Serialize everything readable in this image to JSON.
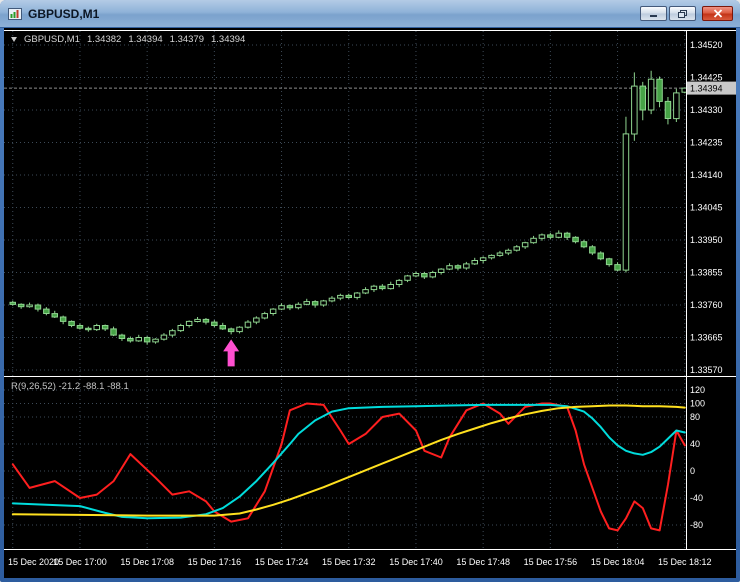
{
  "window": {
    "title": "GBPUSD,M1"
  },
  "header": {
    "symbol": "GBPUSD,M1",
    "open": "1.34382",
    "high": "1.34394",
    "low": "1.34379",
    "close": "1.34394"
  },
  "indicator_header": "R(9,26,52) -21.2 -88.1 -88.1",
  "axes": {
    "price_labels": [
      "1.34520",
      "1.34425",
      "1.34330",
      "1.34235",
      "1.34140",
      "1.34045",
      "1.33950",
      "1.33855",
      "1.33760",
      "1.33665",
      "1.33570"
    ],
    "indicator_labels": [
      "120",
      "100",
      "80",
      "40",
      "0",
      "-40",
      "-80"
    ],
    "time_labels": [
      "15 Dec 2020",
      "15 Dec 17:00",
      "15 Dec 17:08",
      "15 Dec 17:16",
      "15 Dec 17:24",
      "15 Dec 17:32",
      "15 Dec 17:40",
      "15 Dec 17:48",
      "15 Dec 17:56",
      "15 Dec 18:04",
      "15 Dec 18:12"
    ],
    "current_price": "1.34394"
  },
  "colors": {
    "background": "#000000",
    "grid": "#3d4a57",
    "frame": "#ffffff",
    "bull_stroke": "#8fd48f",
    "bear_fill": "#47a347",
    "candle_fill": "#000000",
    "axis_text": "#ffffff",
    "badge_bg": "#c8c8c8",
    "badge_text": "#000000",
    "bid_line": "#8c8c8c",
    "marker": "#ff4fd0",
    "osc_fast": "#ff1f1f",
    "osc_medium": "#00dcdc",
    "osc_slow": "#ffe01f"
  },
  "chart_data": {
    "type": "candlestick",
    "symbol": "GBPUSD",
    "timeframe": "M1",
    "title": "GBPUSD,M1",
    "price_axis_range": [
      1.3357,
      1.3452
    ],
    "last_ohlc": {
      "open": 1.34382,
      "high": 1.34394,
      "low": 1.34379,
      "close": 1.34394
    },
    "candles": [
      [
        1.33768,
        1.33773,
        1.33758,
        1.33762
      ],
      [
        1.33762,
        1.33765,
        1.33749,
        1.33755
      ],
      [
        1.33755,
        1.33767,
        1.33752,
        1.3376
      ],
      [
        1.3376,
        1.33764,
        1.33741,
        1.33748
      ],
      [
        1.33748,
        1.33754,
        1.3373,
        1.33735
      ],
      [
        1.33735,
        1.33743,
        1.33722,
        1.33725
      ],
      [
        1.33725,
        1.33729,
        1.33704,
        1.33712
      ],
      [
        1.33712,
        1.33715,
        1.33695,
        1.337
      ],
      [
        1.337,
        1.33706,
        1.33688,
        1.33692
      ],
      [
        1.33692,
        1.33697,
        1.33682,
        1.33688
      ],
      [
        1.33688,
        1.33705,
        1.33684,
        1.337
      ],
      [
        1.337,
        1.33703,
        1.33684,
        1.3369
      ],
      [
        1.3369,
        1.33697,
        1.33669,
        1.33672
      ],
      [
        1.33672,
        1.33676,
        1.33655,
        1.33662
      ],
      [
        1.33662,
        1.33668,
        1.3365,
        1.33655
      ],
      [
        1.33655,
        1.33673,
        1.33652,
        1.33665
      ],
      [
        1.33665,
        1.33669,
        1.33644,
        1.33652
      ],
      [
        1.33652,
        1.33663,
        1.33647,
        1.3366
      ],
      [
        1.3366,
        1.33678,
        1.33656,
        1.33672
      ],
      [
        1.33672,
        1.3369,
        1.33666,
        1.33685
      ],
      [
        1.33685,
        1.33705,
        1.33681,
        1.337
      ],
      [
        1.337,
        1.33715,
        1.33694,
        1.33712
      ],
      [
        1.33712,
        1.33725,
        1.33709,
        1.33718
      ],
      [
        1.33718,
        1.33722,
        1.33703,
        1.3371
      ],
      [
        1.3371,
        1.33716,
        1.33695,
        1.337
      ],
      [
        1.337,
        1.33708,
        1.33687,
        1.3369
      ],
      [
        1.3369,
        1.33694,
        1.33674,
        1.33682
      ],
      [
        1.33682,
        1.33698,
        1.33677,
        1.33695
      ],
      [
        1.33695,
        1.33716,
        1.33691,
        1.3371
      ],
      [
        1.3371,
        1.33727,
        1.33704,
        1.33722
      ],
      [
        1.33722,
        1.3374,
        1.33718,
        1.33735
      ],
      [
        1.33735,
        1.33751,
        1.33729,
        1.33748
      ],
      [
        1.33748,
        1.33765,
        1.33745,
        1.33758
      ],
      [
        1.33758,
        1.33762,
        1.33745,
        1.33752
      ],
      [
        1.33752,
        1.33768,
        1.33747,
        1.33762
      ],
      [
        1.33762,
        1.33778,
        1.33759,
        1.3377
      ],
      [
        1.3377,
        1.33774,
        1.33752,
        1.3376
      ],
      [
        1.3376,
        1.33775,
        1.33755,
        1.33772
      ],
      [
        1.33772,
        1.33786,
        1.33768,
        1.3378
      ],
      [
        1.3378,
        1.33793,
        1.33774,
        1.33788
      ],
      [
        1.33788,
        1.33793,
        1.33778,
        1.33782
      ],
      [
        1.33782,
        1.33798,
        1.33776,
        1.33795
      ],
      [
        1.33795,
        1.33812,
        1.33792,
        1.33805
      ],
      [
        1.33805,
        1.33819,
        1.33798,
        1.33815
      ],
      [
        1.33815,
        1.33821,
        1.33803,
        1.33808
      ],
      [
        1.33808,
        1.33828,
        1.33805,
        1.3382
      ],
      [
        1.3382,
        1.33836,
        1.33812,
        1.33832
      ],
      [
        1.33832,
        1.33848,
        1.33827,
        1.33845
      ],
      [
        1.33845,
        1.33858,
        1.33841,
        1.33852
      ],
      [
        1.33852,
        1.33857,
        1.33836,
        1.33842
      ],
      [
        1.33842,
        1.3386,
        1.33838,
        1.33855
      ],
      [
        1.33855,
        1.33868,
        1.33849,
        1.33865
      ],
      [
        1.33865,
        1.33882,
        1.33862,
        1.33875
      ],
      [
        1.33875,
        1.33879,
        1.33861,
        1.33868
      ],
      [
        1.33868,
        1.33886,
        1.33863,
        1.3388
      ],
      [
        1.3388,
        1.33898,
        1.33877,
        1.3389
      ],
      [
        1.3389,
        1.33902,
        1.33882,
        1.33898
      ],
      [
        1.33898,
        1.33908,
        1.33893,
        1.33905
      ],
      [
        1.33905,
        1.33918,
        1.33901,
        1.33912
      ],
      [
        1.33912,
        1.33925,
        1.33906,
        1.3392
      ],
      [
        1.3392,
        1.33935,
        1.33916,
        1.3393
      ],
      [
        1.3393,
        1.33945,
        1.33924,
        1.33942
      ],
      [
        1.33942,
        1.33962,
        1.33939,
        1.33955
      ],
      [
        1.33955,
        1.33969,
        1.33948,
        1.33965
      ],
      [
        1.33965,
        1.33971,
        1.33953,
        1.33958
      ],
      [
        1.33958,
        1.33978,
        1.33955,
        1.3397
      ],
      [
        1.3397,
        1.33974,
        1.3395,
        1.33958
      ],
      [
        1.33958,
        1.33961,
        1.3394,
        1.33945
      ],
      [
        1.33945,
        1.33951,
        1.33926,
        1.3393
      ],
      [
        1.3393,
        1.33935,
        1.33906,
        1.33912
      ],
      [
        1.33912,
        1.33917,
        1.33891,
        1.33895
      ],
      [
        1.33895,
        1.33898,
        1.33872,
        1.33878
      ],
      [
        1.33878,
        1.33885,
        1.33859,
        1.33862
      ],
      [
        1.33862,
        1.3431,
        1.33855,
        1.3426
      ],
      [
        1.3426,
        1.3444,
        1.3424,
        1.344
      ],
      [
        1.344,
        1.34412,
        1.343,
        1.3433
      ],
      [
        1.3433,
        1.34445,
        1.34318,
        1.3442
      ],
      [
        1.3442,
        1.34428,
        1.34338,
        1.34355
      ],
      [
        1.34355,
        1.34368,
        1.34288,
        1.34305
      ],
      [
        1.34305,
        1.34392,
        1.34295,
        1.3438
      ],
      [
        1.34382,
        1.34394,
        1.34379,
        1.34394
      ]
    ],
    "marker": {
      "type": "buy-arrow",
      "candle_index": 26,
      "color": "#ff4fd0"
    },
    "oscillator": {
      "title": "R(9,26,52)",
      "values_text": [
        "-21.2",
        "-88.1",
        "-88.1"
      ],
      "levels": [
        120,
        100,
        80,
        40,
        0,
        -40,
        -80
      ],
      "range": [
        -112,
        128
      ],
      "series": [
        {
          "name": "fast",
          "color": "#ff1f1f",
          "points": [
            [
              0,
              10
            ],
            [
              2,
              -25
            ],
            [
              5,
              -15
            ],
            [
              8,
              -40
            ],
            [
              10,
              -35
            ],
            [
              12,
              -15
            ],
            [
              14,
              25
            ],
            [
              17,
              -10
            ],
            [
              19,
              -35
            ],
            [
              21,
              -30
            ],
            [
              23,
              -45
            ],
            [
              24,
              -60
            ],
            [
              26,
              -75
            ],
            [
              28,
              -70
            ],
            [
              30,
              -30
            ],
            [
              32,
              40
            ],
            [
              33,
              90
            ],
            [
              35,
              100
            ],
            [
              37,
              98
            ],
            [
              39,
              60
            ],
            [
              40,
              40
            ],
            [
              42,
              55
            ],
            [
              44,
              80
            ],
            [
              46,
              85
            ],
            [
              48,
              60
            ],
            [
              49,
              30
            ],
            [
              51,
              20
            ],
            [
              52,
              50
            ],
            [
              54,
              90
            ],
            [
              56,
              100
            ],
            [
              58,
              85
            ],
            [
              59,
              70
            ],
            [
              61,
              95
            ],
            [
              63,
              100
            ],
            [
              64,
              100
            ],
            [
              66,
              95
            ],
            [
              67,
              60
            ],
            [
              68,
              10
            ],
            [
              70,
              -60
            ],
            [
              71,
              -85
            ],
            [
              72,
              -88
            ],
            [
              73,
              -70
            ],
            [
              74,
              -45
            ],
            [
              75,
              -55
            ],
            [
              76,
              -85
            ],
            [
              77,
              -88
            ],
            [
              78,
              -20
            ],
            [
              79,
              60
            ],
            [
              80,
              38
            ]
          ]
        },
        {
          "name": "medium",
          "color": "#00dcdc",
          "points": [
            [
              0,
              -48
            ],
            [
              4,
              -50
            ],
            [
              8,
              -52
            ],
            [
              11,
              -62
            ],
            [
              13,
              -68
            ],
            [
              16,
              -70
            ],
            [
              20,
              -69
            ],
            [
              23,
              -64
            ],
            [
              25,
              -55
            ],
            [
              27,
              -38
            ],
            [
              29,
              -15
            ],
            [
              31,
              12
            ],
            [
              33,
              40
            ],
            [
              34,
              55
            ],
            [
              36,
              75
            ],
            [
              38,
              88
            ],
            [
              40,
              93
            ],
            [
              44,
              95
            ],
            [
              48,
              96
            ],
            [
              52,
              97
            ],
            [
              56,
              98
            ],
            [
              60,
              98
            ],
            [
              64,
              98
            ],
            [
              66,
              96
            ],
            [
              68,
              88
            ],
            [
              69,
              78
            ],
            [
              70,
              65
            ],
            [
              71,
              50
            ],
            [
              72,
              38
            ],
            [
              73,
              30
            ],
            [
              74,
              26
            ],
            [
              75,
              24
            ],
            [
              76,
              28
            ],
            [
              77,
              36
            ],
            [
              78,
              48
            ],
            [
              79,
              60
            ],
            [
              80,
              57
            ]
          ]
        },
        {
          "name": "slow",
          "color": "#ffe01f",
          "points": [
            [
              0,
              -64
            ],
            [
              8,
              -65
            ],
            [
              16,
              -66
            ],
            [
              24,
              -66
            ],
            [
              27,
              -63
            ],
            [
              29,
              -57
            ],
            [
              31,
              -50
            ],
            [
              33,
              -42
            ],
            [
              35,
              -33
            ],
            [
              37,
              -24
            ],
            [
              39,
              -14
            ],
            [
              41,
              -4
            ],
            [
              43,
              6
            ],
            [
              45,
              16
            ],
            [
              47,
              26
            ],
            [
              49,
              36
            ],
            [
              51,
              46
            ],
            [
              53,
              55
            ],
            [
              55,
              63
            ],
            [
              57,
              71
            ],
            [
              59,
              78
            ],
            [
              61,
              84
            ],
            [
              63,
              89
            ],
            [
              65,
              93
            ],
            [
              67,
              95
            ],
            [
              69,
              96
            ],
            [
              71,
              97
            ],
            [
              73,
              97
            ],
            [
              75,
              96
            ],
            [
              77,
              96
            ],
            [
              79,
              95
            ],
            [
              80,
              94
            ]
          ]
        }
      ]
    }
  }
}
